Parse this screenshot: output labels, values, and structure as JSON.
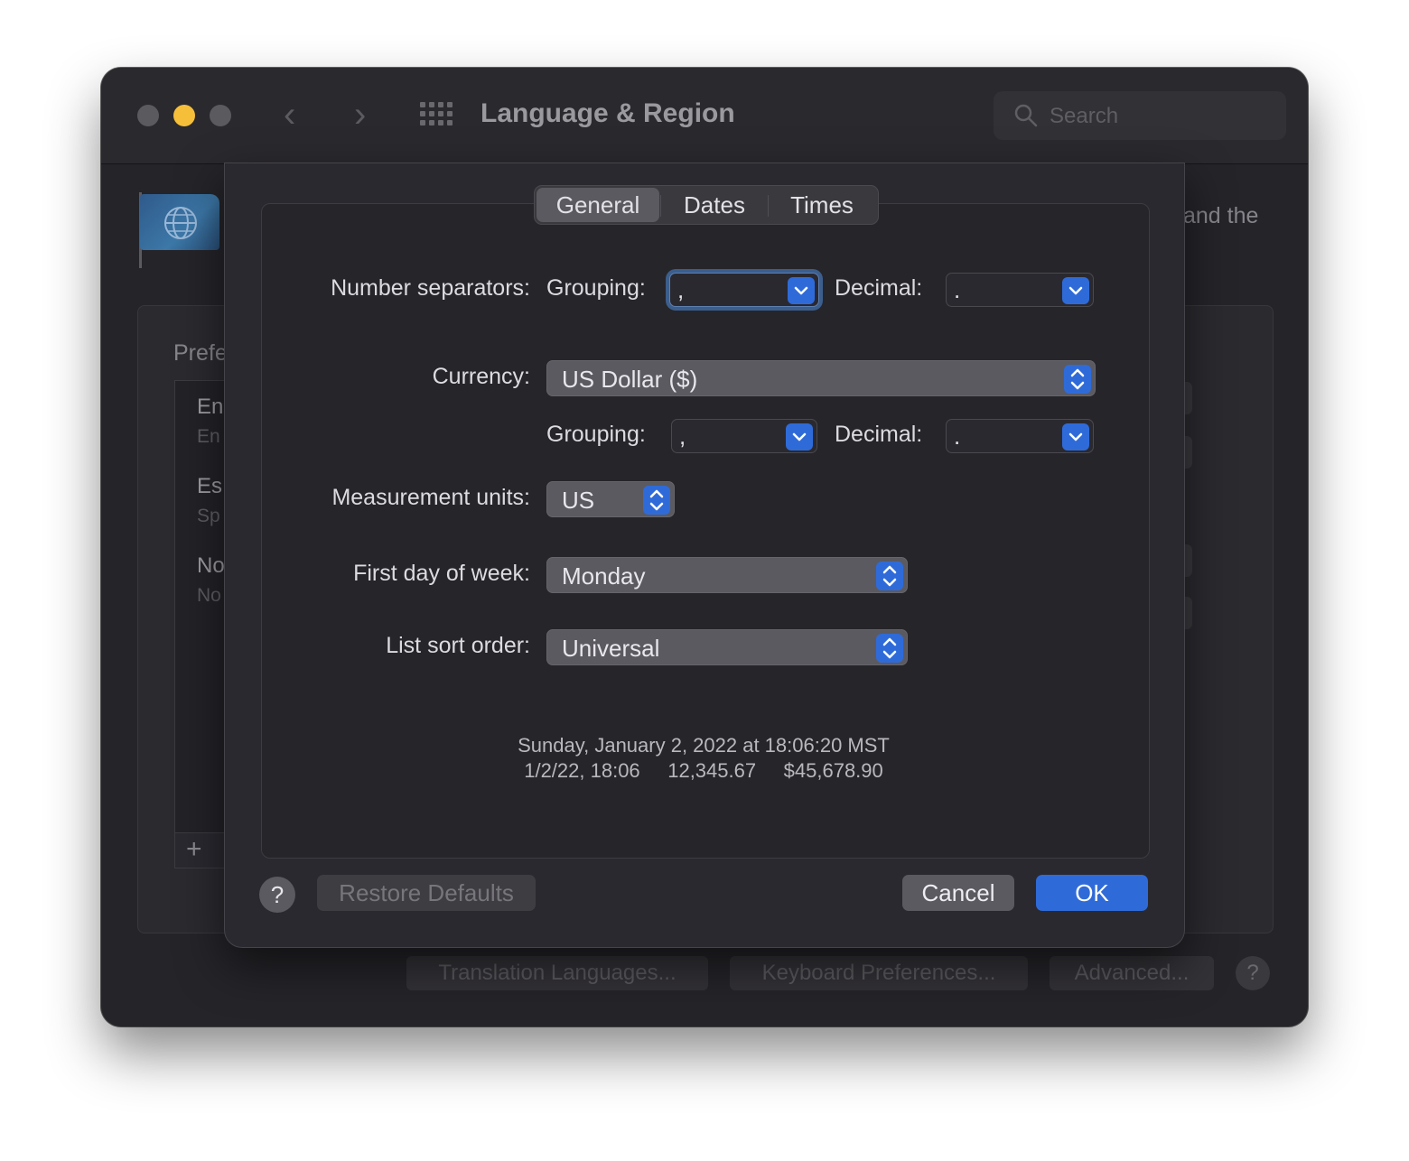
{
  "window": {
    "title": "Language & Region",
    "search_placeholder": "Search"
  },
  "background": {
    "header_text_partial": "and the",
    "prefs_label_partial": "Prefe",
    "languages": [
      {
        "main": "En",
        "sub": "En"
      },
      {
        "main": "Es",
        "sub": "Sp"
      },
      {
        "main": "No",
        "sub": "No"
      }
    ],
    "add_label": "+",
    "buttons": {
      "translation": "Translation Languages...",
      "keyboard": "Keyboard Preferences...",
      "advanced": "Advanced...",
      "help": "?"
    }
  },
  "sheet": {
    "tabs": [
      {
        "label": "General",
        "active": true
      },
      {
        "label": "Dates",
        "active": false
      },
      {
        "label": "Times",
        "active": false
      }
    ],
    "number_separators": {
      "label": "Number separators:",
      "grouping_label": "Grouping:",
      "grouping_value": ",",
      "decimal_label": "Decimal:",
      "decimal_value": "."
    },
    "currency": {
      "label": "Currency:",
      "value": "US Dollar ($)",
      "grouping_label": "Grouping:",
      "grouping_value": ",",
      "decimal_label": "Decimal:",
      "decimal_value": "."
    },
    "measurement": {
      "label": "Measurement units:",
      "value": "US"
    },
    "first_day": {
      "label": "First day of week:",
      "value": "Monday"
    },
    "sort_order": {
      "label": "List sort order:",
      "value": "Universal"
    },
    "sample": {
      "line1": "Sunday, January 2, 2022 at 18:06:20 MST",
      "line2": "1/2/22, 18:06     12,345.67     $45,678.90"
    },
    "buttons": {
      "help": "?",
      "restore": "Restore Defaults",
      "cancel": "Cancel",
      "ok": "OK"
    }
  },
  "colors": {
    "accent": "#2f6bd8",
    "window_bg": "#252429",
    "sheet_bg": "#2a2930",
    "minimize_light": "#f5bf3a"
  }
}
